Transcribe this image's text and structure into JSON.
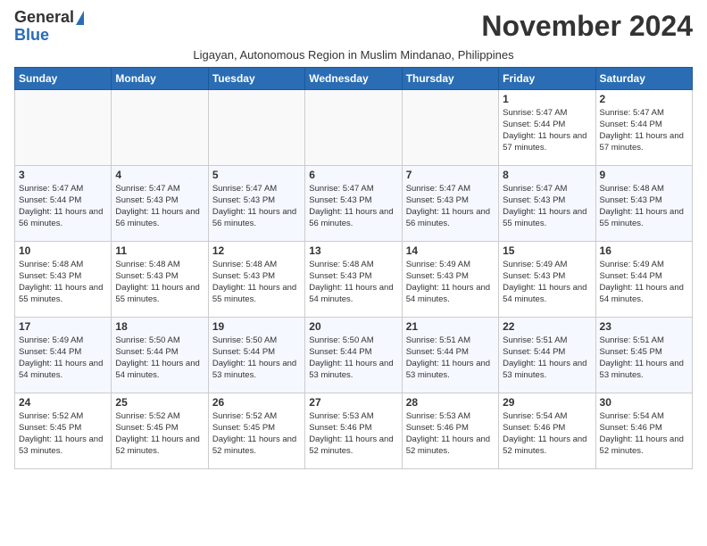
{
  "header": {
    "logo_general": "General",
    "logo_blue": "Blue",
    "month_title": "November 2024",
    "subtitle": "Ligayan, Autonomous Region in Muslim Mindanao, Philippines"
  },
  "weekdays": [
    "Sunday",
    "Monday",
    "Tuesday",
    "Wednesday",
    "Thursday",
    "Friday",
    "Saturday"
  ],
  "weeks": [
    [
      {
        "day": "",
        "info": ""
      },
      {
        "day": "",
        "info": ""
      },
      {
        "day": "",
        "info": ""
      },
      {
        "day": "",
        "info": ""
      },
      {
        "day": "",
        "info": ""
      },
      {
        "day": "1",
        "info": "Sunrise: 5:47 AM\nSunset: 5:44 PM\nDaylight: 11 hours and 57 minutes."
      },
      {
        "day": "2",
        "info": "Sunrise: 5:47 AM\nSunset: 5:44 PM\nDaylight: 11 hours and 57 minutes."
      }
    ],
    [
      {
        "day": "3",
        "info": "Sunrise: 5:47 AM\nSunset: 5:44 PM\nDaylight: 11 hours and 56 minutes."
      },
      {
        "day": "4",
        "info": "Sunrise: 5:47 AM\nSunset: 5:43 PM\nDaylight: 11 hours and 56 minutes."
      },
      {
        "day": "5",
        "info": "Sunrise: 5:47 AM\nSunset: 5:43 PM\nDaylight: 11 hours and 56 minutes."
      },
      {
        "day": "6",
        "info": "Sunrise: 5:47 AM\nSunset: 5:43 PM\nDaylight: 11 hours and 56 minutes."
      },
      {
        "day": "7",
        "info": "Sunrise: 5:47 AM\nSunset: 5:43 PM\nDaylight: 11 hours and 56 minutes."
      },
      {
        "day": "8",
        "info": "Sunrise: 5:47 AM\nSunset: 5:43 PM\nDaylight: 11 hours and 55 minutes."
      },
      {
        "day": "9",
        "info": "Sunrise: 5:48 AM\nSunset: 5:43 PM\nDaylight: 11 hours and 55 minutes."
      }
    ],
    [
      {
        "day": "10",
        "info": "Sunrise: 5:48 AM\nSunset: 5:43 PM\nDaylight: 11 hours and 55 minutes."
      },
      {
        "day": "11",
        "info": "Sunrise: 5:48 AM\nSunset: 5:43 PM\nDaylight: 11 hours and 55 minutes."
      },
      {
        "day": "12",
        "info": "Sunrise: 5:48 AM\nSunset: 5:43 PM\nDaylight: 11 hours and 55 minutes."
      },
      {
        "day": "13",
        "info": "Sunrise: 5:48 AM\nSunset: 5:43 PM\nDaylight: 11 hours and 54 minutes."
      },
      {
        "day": "14",
        "info": "Sunrise: 5:49 AM\nSunset: 5:43 PM\nDaylight: 11 hours and 54 minutes."
      },
      {
        "day": "15",
        "info": "Sunrise: 5:49 AM\nSunset: 5:43 PM\nDaylight: 11 hours and 54 minutes."
      },
      {
        "day": "16",
        "info": "Sunrise: 5:49 AM\nSunset: 5:44 PM\nDaylight: 11 hours and 54 minutes."
      }
    ],
    [
      {
        "day": "17",
        "info": "Sunrise: 5:49 AM\nSunset: 5:44 PM\nDaylight: 11 hours and 54 minutes."
      },
      {
        "day": "18",
        "info": "Sunrise: 5:50 AM\nSunset: 5:44 PM\nDaylight: 11 hours and 54 minutes."
      },
      {
        "day": "19",
        "info": "Sunrise: 5:50 AM\nSunset: 5:44 PM\nDaylight: 11 hours and 53 minutes."
      },
      {
        "day": "20",
        "info": "Sunrise: 5:50 AM\nSunset: 5:44 PM\nDaylight: 11 hours and 53 minutes."
      },
      {
        "day": "21",
        "info": "Sunrise: 5:51 AM\nSunset: 5:44 PM\nDaylight: 11 hours and 53 minutes."
      },
      {
        "day": "22",
        "info": "Sunrise: 5:51 AM\nSunset: 5:44 PM\nDaylight: 11 hours and 53 minutes."
      },
      {
        "day": "23",
        "info": "Sunrise: 5:51 AM\nSunset: 5:45 PM\nDaylight: 11 hours and 53 minutes."
      }
    ],
    [
      {
        "day": "24",
        "info": "Sunrise: 5:52 AM\nSunset: 5:45 PM\nDaylight: 11 hours and 53 minutes."
      },
      {
        "day": "25",
        "info": "Sunrise: 5:52 AM\nSunset: 5:45 PM\nDaylight: 11 hours and 52 minutes."
      },
      {
        "day": "26",
        "info": "Sunrise: 5:52 AM\nSunset: 5:45 PM\nDaylight: 11 hours and 52 minutes."
      },
      {
        "day": "27",
        "info": "Sunrise: 5:53 AM\nSunset: 5:46 PM\nDaylight: 11 hours and 52 minutes."
      },
      {
        "day": "28",
        "info": "Sunrise: 5:53 AM\nSunset: 5:46 PM\nDaylight: 11 hours and 52 minutes."
      },
      {
        "day": "29",
        "info": "Sunrise: 5:54 AM\nSunset: 5:46 PM\nDaylight: 11 hours and 52 minutes."
      },
      {
        "day": "30",
        "info": "Sunrise: 5:54 AM\nSunset: 5:46 PM\nDaylight: 11 hours and 52 minutes."
      }
    ]
  ]
}
